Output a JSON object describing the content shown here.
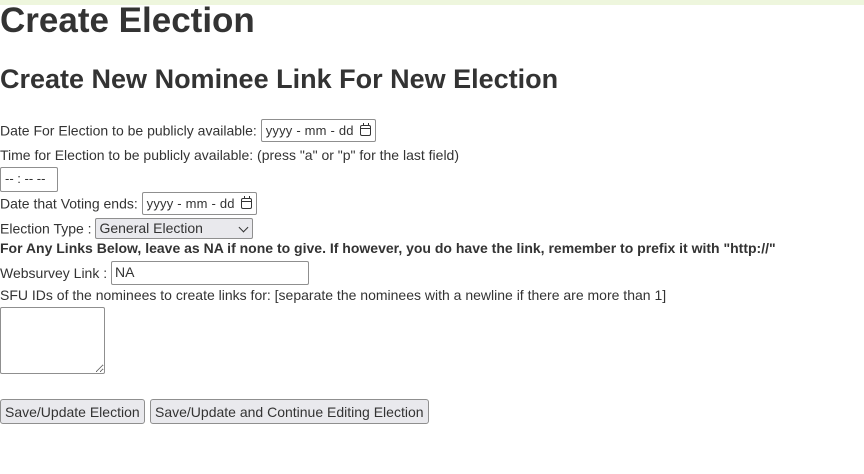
{
  "page": {
    "title": "Create Election",
    "subtitle": "Create New Nominee Link For New Election"
  },
  "form": {
    "public_date_label": "Date For Election to be publicly available:",
    "public_date_placeholder": "yyyy - mm - dd",
    "public_time_label": "Time for Election to be publicly available: (press \"a\" or \"p\" for the last field)",
    "public_time_placeholder": "-- : --   --",
    "voting_end_label": "Date that Voting ends:",
    "voting_end_placeholder": "yyyy - mm - dd",
    "election_type_label": "Election Type :",
    "election_type_selected": "General Election",
    "links_note": "For Any Links Below, leave as NA if none to give. If however, you do have the link, remember to prefix it with \"http://\"",
    "websurvey_label": "Websurvey Link :",
    "websurvey_value": "NA",
    "sfu_ids_label": "SFU IDs of the nominees to create links for: [separate the nominees with a newline if there are more than 1]",
    "sfu_ids_value": ""
  },
  "buttons": {
    "save": "Save/Update Election",
    "save_continue": "Save/Update and Continue Editing Election"
  },
  "icons": {
    "calendar": "calendar-icon",
    "dropdown": "chevron-down-icon"
  }
}
